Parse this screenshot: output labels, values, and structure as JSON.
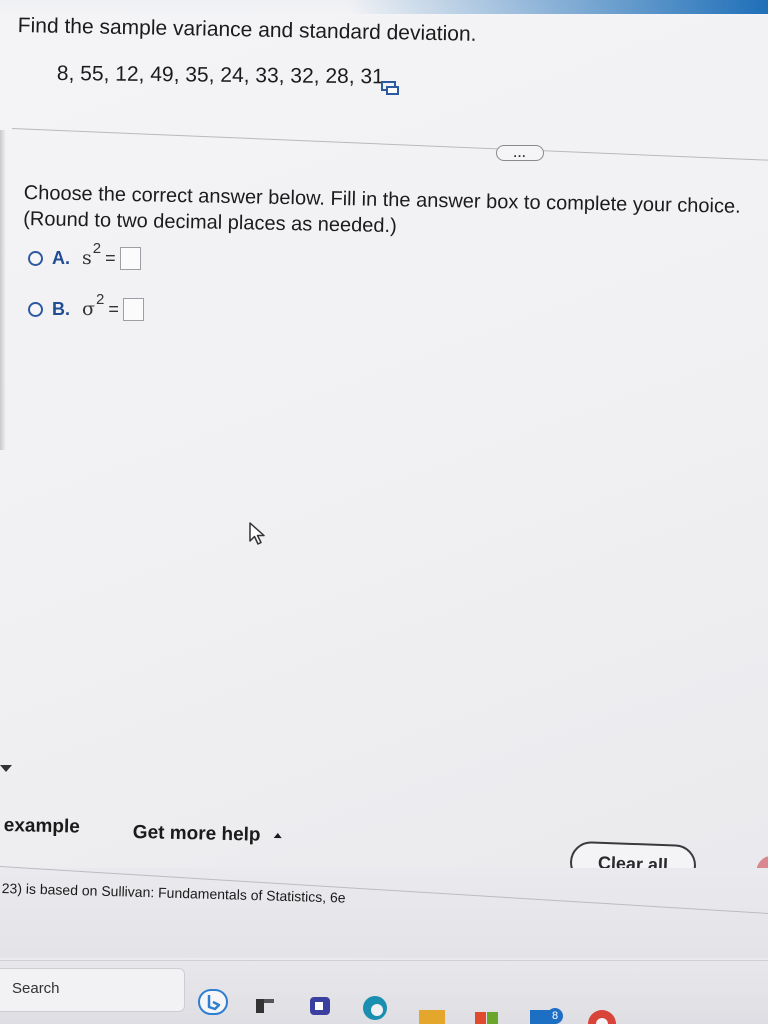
{
  "question": {
    "title": "Find the sample variance and standard deviation.",
    "data_values": "8, 55, 12, 49, 35, 24, 33, 32, 28, 31",
    "copy_icon": "copy-data-icon"
  },
  "more_button": {
    "label": "..."
  },
  "instructions": {
    "line1": "Choose the correct answer below. Fill in the answer box to complete your choice.",
    "line2": "(Round to two decimal places as needed.)"
  },
  "choices": [
    {
      "letter": "A.",
      "symbol": "s",
      "exponent": "2",
      "equals": "=",
      "value": ""
    },
    {
      "letter": "B.",
      "symbol": "σ",
      "exponent": "2",
      "equals": "=",
      "value": ""
    }
  ],
  "toolbar": {
    "example_label": "example",
    "help_label": "Get more help",
    "clear_all_label": "Clear all"
  },
  "footer": {
    "source_text": "23) is based on Sullivan: Fundamentals of Statistics, 6e"
  },
  "taskbar": {
    "search_label": "Search",
    "badge_count": "8",
    "icons": [
      "bing-icon",
      "file-explorer-icon",
      "teams-icon",
      "edge-icon",
      "folder-icon",
      "store-icon",
      "mail-icon",
      "chrome-icon"
    ]
  },
  "colors": {
    "radio_blue": "#2c5aa0",
    "choice_letter_blue": "#1f4d93",
    "text": "#1b1b1b"
  }
}
